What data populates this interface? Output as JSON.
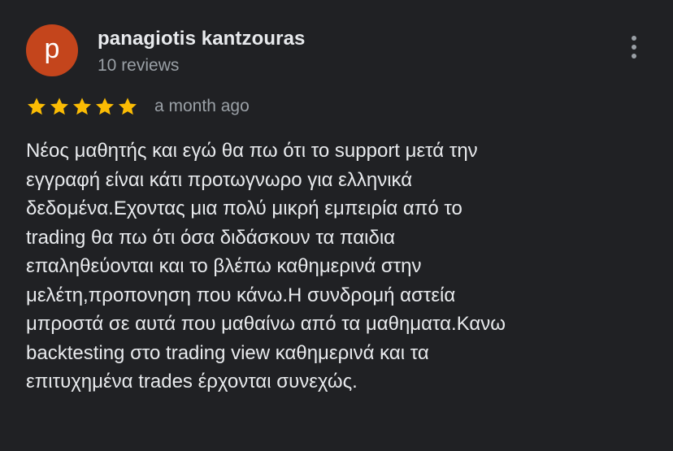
{
  "review": {
    "avatar_letter": "p",
    "avatar_color": "#c4451c",
    "author_name": "panagiotis kantzouras",
    "review_count": "10 reviews",
    "rating": 5,
    "max_rating": 5,
    "star_color": "#fbbc04",
    "time": "a month ago",
    "text": "Νέος μαθητής και εγώ θα πω ότι το support μετά την\nεγγραφή είναι κάτι προτωγνωρο για ελληνικά\nδεδομένα.Εχοντας μια πολύ μικρή εμπειρία από το\ntrading θα πω ότι όσα διδάσκουν τα παιδια\nεπαληθεύονται και το βλέπω καθημερινά στην\nμελέτη,προπονηση που κάνω.Η συνδρομή αστεία\nμπροστά σε αυτά που μαθαίνω από τα μαθηματα.Κανω\nbacktesting στο trading view καθημερινά και τα\nεπιτυχημένα trades έρχονται συνεχώς."
  },
  "icons": {
    "more": "more-vert-icon",
    "star": "star-icon"
  }
}
